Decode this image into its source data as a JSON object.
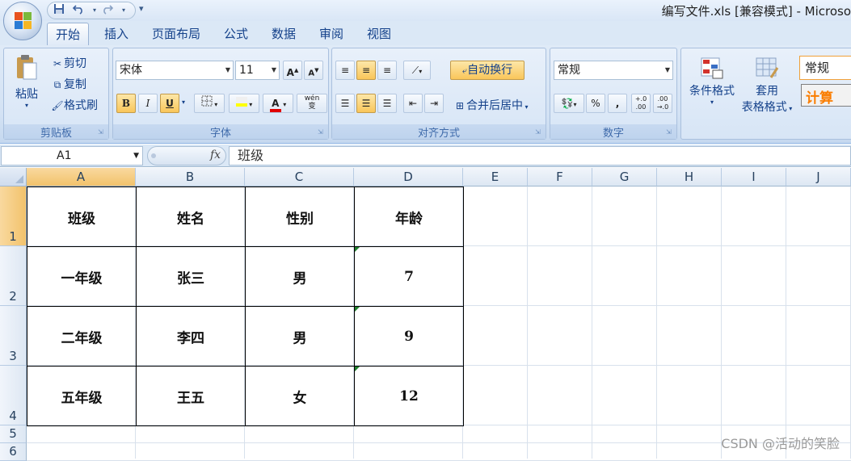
{
  "window": {
    "title": "编写文件.xls  [兼容模式] - Microso"
  },
  "quick_access": {
    "save_icon": "save-icon",
    "undo_icon": "undo-icon",
    "redo_icon": "redo-icon",
    "menu_glyph": "▾"
  },
  "tabs": [
    {
      "label": "开始",
      "active": true
    },
    {
      "label": "插入"
    },
    {
      "label": "页面布局"
    },
    {
      "label": "公式"
    },
    {
      "label": "数据"
    },
    {
      "label": "审阅"
    },
    {
      "label": "视图"
    }
  ],
  "ribbon": {
    "clipboard": {
      "label": "剪贴板",
      "paste": "粘贴",
      "cut": "剪切",
      "copy": "复制",
      "format_painter": "格式刷"
    },
    "font": {
      "label": "字体",
      "font_name": "宋体",
      "font_size": "11",
      "bold": "B",
      "italic": "I",
      "underline": "U",
      "grow": "A",
      "shrink": "A",
      "phonetic": "wén",
      "phonetic_char": "变"
    },
    "alignment": {
      "label": "对齐方式",
      "wrap_text": "自动换行",
      "merge_center": "合并后居中"
    },
    "number": {
      "label": "数字",
      "format": "常规",
      "percent": "%",
      "comma": ",",
      "inc_decimal": "+.0 .00",
      "dec_decimal": ".00 →.0"
    },
    "styles": {
      "conditional": "条件格式",
      "table_format_1": "套用",
      "table_format_2": "表格格式",
      "style_normal": "常规",
      "style_calc": "计算"
    }
  },
  "formula_bar": {
    "name_box": "A1",
    "fx": "fx",
    "content": "班级"
  },
  "columns": [
    "A",
    "B",
    "C",
    "D",
    "E",
    "F",
    "G",
    "H",
    "I",
    "J"
  ],
  "rows": [
    "1",
    "2",
    "3",
    "4",
    "5",
    "6"
  ],
  "cells": [
    [
      "班级",
      "姓名",
      "性别",
      "年龄"
    ],
    [
      "一年级",
      "张三",
      "男",
      "7"
    ],
    [
      "二年级",
      "李四",
      "男",
      "9"
    ],
    [
      "五年级",
      "王五",
      "女",
      "12"
    ]
  ],
  "watermark": "CSDN @活动的笑脸",
  "colors": {
    "accent": "#15428b",
    "selected_header": "#f2c26b",
    "error_marker": "#1e7d2b"
  }
}
